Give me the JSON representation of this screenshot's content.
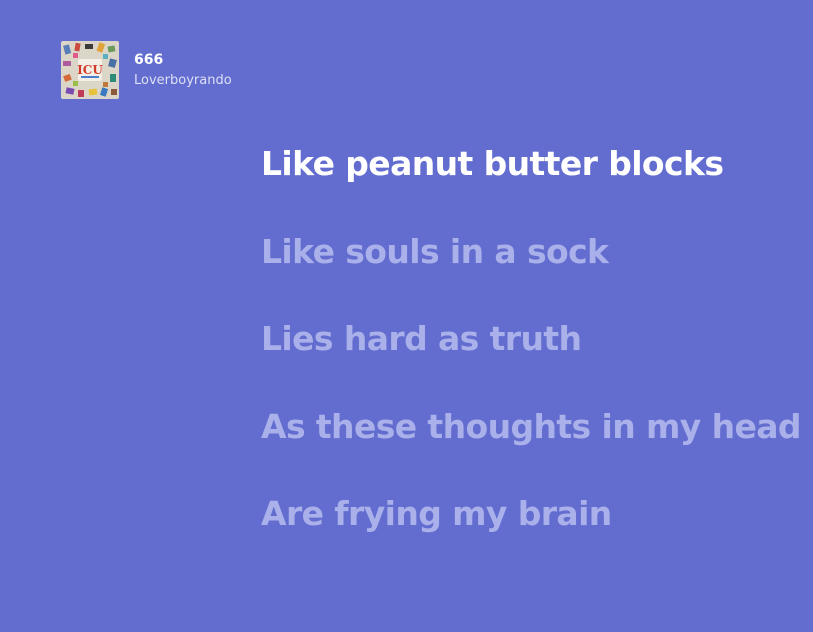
{
  "now_playing": {
    "track_title": "666",
    "artist": "Loverboyrando",
    "album_cover_icon": "album-cover-art"
  },
  "lyrics": {
    "active_index": 0,
    "lines": [
      "Like peanut butter blocks",
      "Like souls in a sock",
      "Lies hard as truth",
      "As these thoughts in my head",
      "Are frying my brain"
    ]
  },
  "colors": {
    "background": "#636dcf",
    "active_lyric": "#ffffff",
    "inactive_lyric": "#a9b0ea"
  }
}
